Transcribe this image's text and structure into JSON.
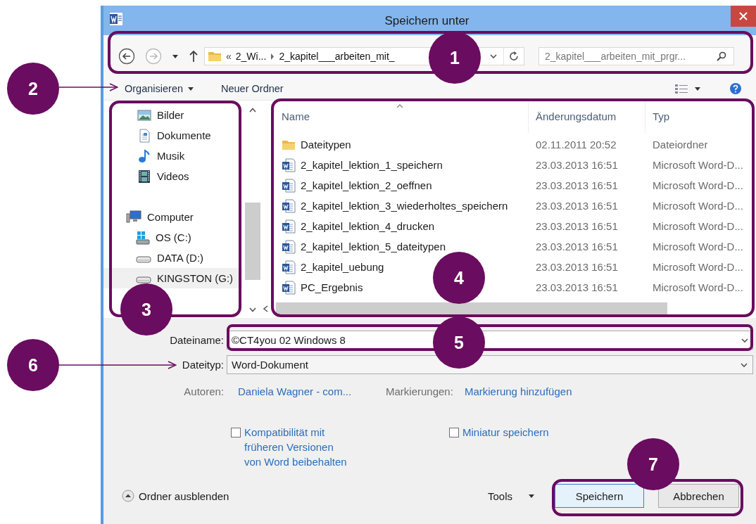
{
  "window": {
    "title": "Speichern unter"
  },
  "navigation": {
    "overflow": "«",
    "breadcrumbs": [
      "2_Wi...",
      "2_kapitel___arbeiten_mit_"
    ],
    "search": {
      "placeholder": "2_kapitel___arbeiten_mit_prgr..."
    }
  },
  "toolbar": {
    "organize": "Organisieren",
    "new_folder": "Neuer Ordner"
  },
  "sidebar": {
    "items": [
      {
        "label": "Bilder",
        "kind": "pictures",
        "selected": false
      },
      {
        "label": "Dokumente",
        "kind": "documents",
        "selected": false
      },
      {
        "label": "Musik",
        "kind": "music",
        "selected": false
      },
      {
        "label": "Videos",
        "kind": "videos",
        "selected": false
      },
      {
        "kind": "spacer"
      },
      {
        "label": "Computer",
        "kind": "computer",
        "selected": false
      },
      {
        "label": "OS (C:)",
        "kind": "system-drive",
        "selected": false
      },
      {
        "label": "DATA (D:)",
        "kind": "drive",
        "selected": false
      },
      {
        "label": "KINGSTON (G:)",
        "kind": "drive",
        "selected": true
      }
    ]
  },
  "file_list": {
    "columns": [
      "Name",
      "Änderungsdatum",
      "Typ"
    ],
    "rows": [
      {
        "kind": "folder",
        "name": "Dateitypen",
        "date": "02.11.2011 20:52",
        "type": "Dateiordner"
      },
      {
        "kind": "word",
        "name": "2_kapitel_lektion_1_speichern",
        "date": "23.03.2013 16:51",
        "type": "Microsoft Word-D..."
      },
      {
        "kind": "word",
        "name": "2_kapitel_lektion_2_oeffnen",
        "date": "23.03.2013 16:51",
        "type": "Microsoft Word-D..."
      },
      {
        "kind": "word",
        "name": "2_kapitel_lektion_3_wiederholtes_speichern",
        "date": "23.03.2013 16:51",
        "type": "Microsoft Word-D..."
      },
      {
        "kind": "word",
        "name": "2_kapitel_lektion_4_drucken",
        "date": "23.03.2013 16:51",
        "type": "Microsoft Word-D..."
      },
      {
        "kind": "word",
        "name": "2_kapitel_lektion_5_dateitypen",
        "date": "23.03.2013 16:51",
        "type": "Microsoft Word-D..."
      },
      {
        "kind": "word",
        "name": "2_kapitel_uebung",
        "date": "23.03.2013 16:51",
        "type": "Microsoft Word-D..."
      },
      {
        "kind": "word",
        "name": "PC_Ergebnis",
        "date": "23.03.2013 16:51",
        "type": "Microsoft Word-D..."
      }
    ]
  },
  "form": {
    "file_name": {
      "label": "Dateiname:",
      "value": "©CT4you 02 Windows 8"
    },
    "file_type": {
      "label": "Dateityp:",
      "value": "Word-Dokument"
    },
    "authors": {
      "label": "Autoren:",
      "value": "Daniela Wagner - com..."
    },
    "tags": {
      "label": "Markierungen:",
      "value": "Markierung hinzufügen"
    },
    "options": [
      {
        "label": "Kompatibilität mit früheren Versionen von Word beibehalten",
        "checked": false
      },
      {
        "label": "Miniatur speichern",
        "checked": false
      }
    ]
  },
  "footer": {
    "hide_folders": "Ordner ausblenden",
    "tools": "Tools",
    "buttons": [
      {
        "label": "Speichern",
        "default": true
      },
      {
        "label": "Abbrechen",
        "default": false
      }
    ]
  },
  "annotations": [
    {
      "number": "1"
    },
    {
      "number": "2"
    },
    {
      "number": "3"
    },
    {
      "number": "4"
    },
    {
      "number": "5"
    },
    {
      "number": "6"
    },
    {
      "number": "7"
    }
  ]
}
